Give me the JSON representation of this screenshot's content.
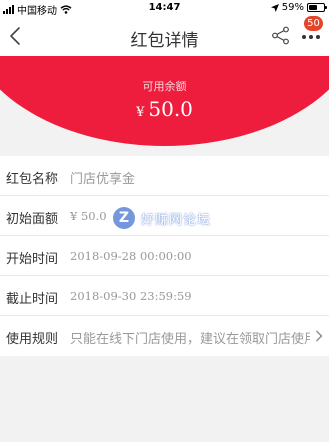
{
  "status_bar": {
    "carrier": "中国移动",
    "time": "14:47",
    "battery_percent": "59%",
    "battery_level": 0.59
  },
  "nav": {
    "title": "红包详情",
    "badge_count": "50"
  },
  "hero": {
    "label": "可用余额",
    "currency": "¥",
    "amount": "50.0"
  },
  "details": [
    {
      "key": "红包名称",
      "value": "门店优享金"
    },
    {
      "key": "初始面额",
      "value": "¥ 50.0"
    },
    {
      "key": "开始时间",
      "value": "2018-09-28 00:00:00"
    },
    {
      "key": "截止时间",
      "value": "2018-09-30 23:59:59"
    },
    {
      "key": "使用规则",
      "value": "只能在线下门店使用，建议在领取门店使用。"
    }
  ],
  "watermark": {
    "text": "好赚网论坛"
  },
  "colors": {
    "accent_red": "#ee1d3d",
    "badge": "#e2452a"
  }
}
